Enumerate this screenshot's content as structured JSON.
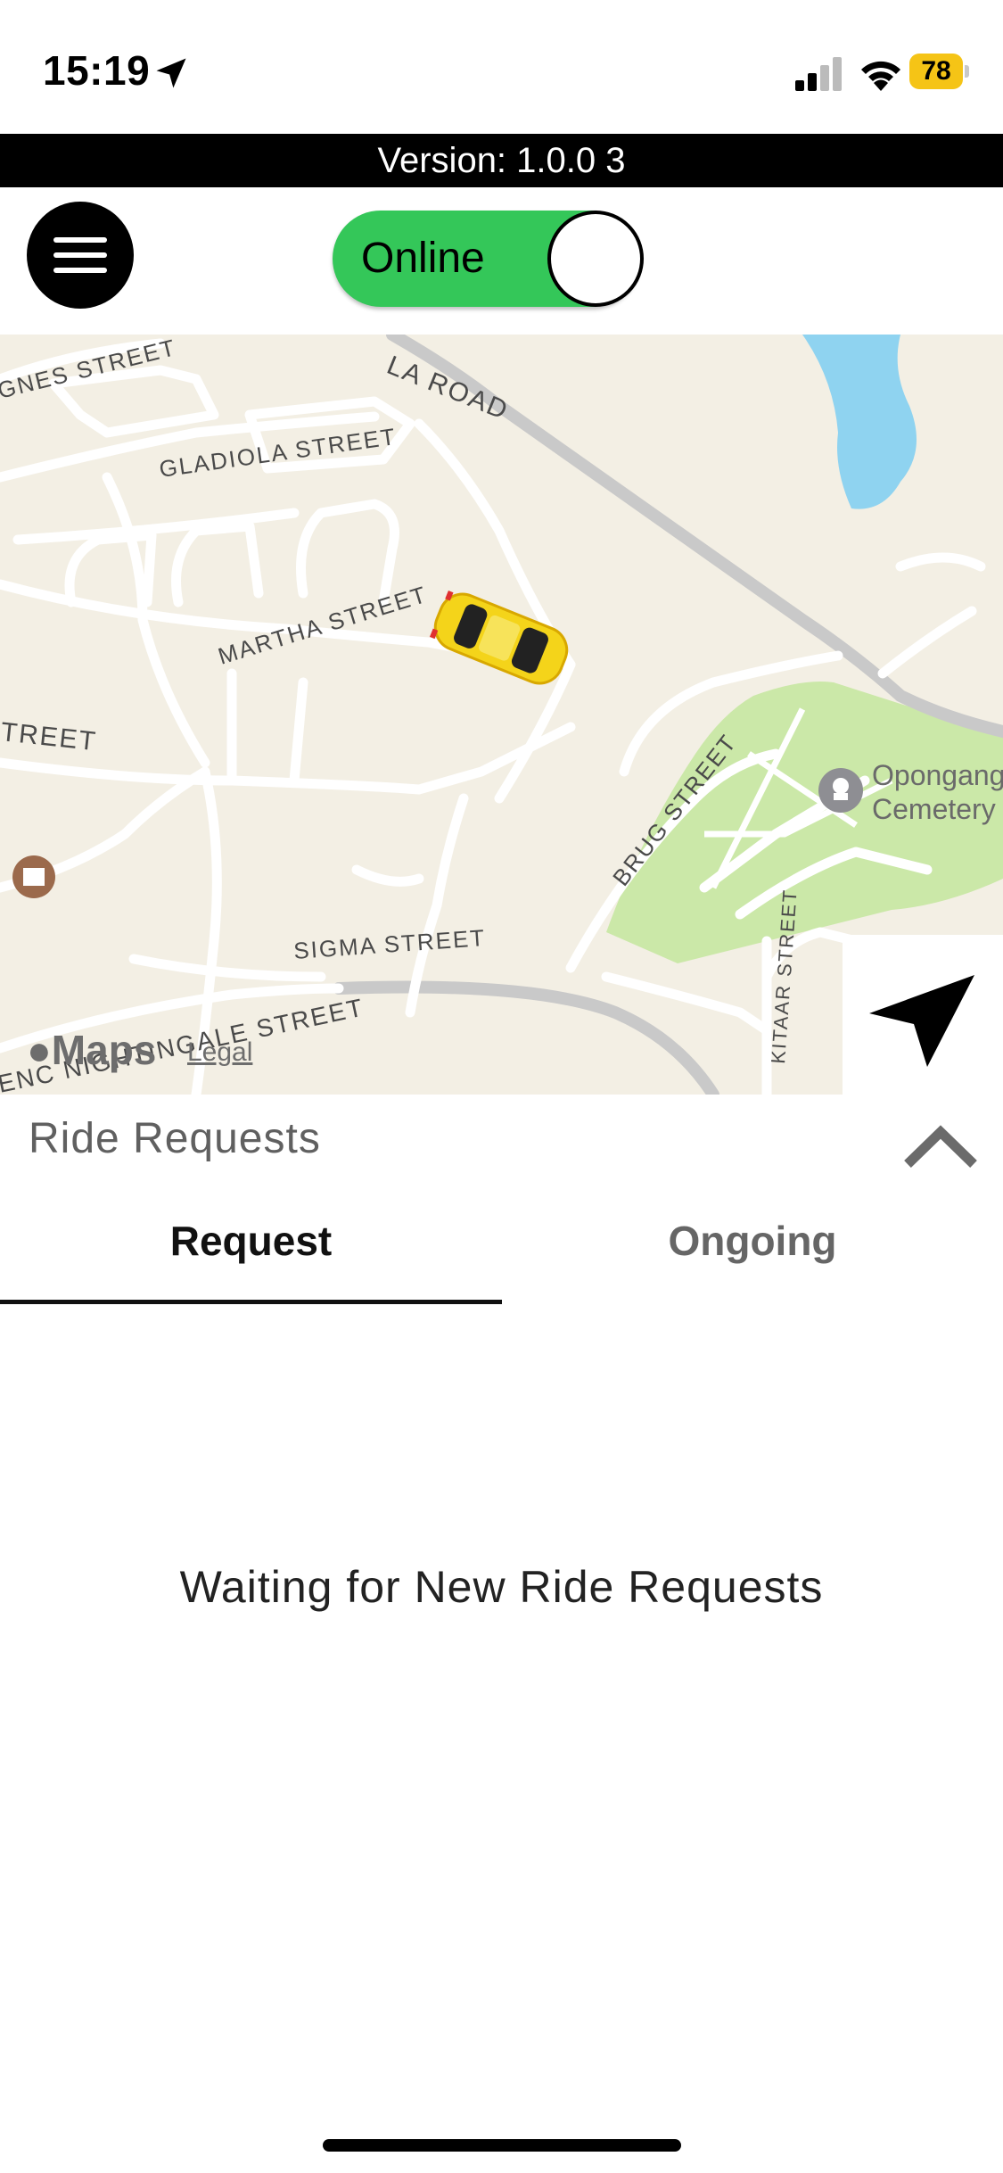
{
  "status_bar": {
    "time": "15:19",
    "battery": "78",
    "icons": [
      "location-arrow-icon",
      "signal-icon",
      "wifi-icon",
      "battery-icon"
    ]
  },
  "version_bar": {
    "text": "Version: 1.0.0 3"
  },
  "header": {
    "menu_icon": "hamburger-menu-icon",
    "toggle": {
      "label": "Online",
      "state": "on",
      "color": "#34c759"
    }
  },
  "map": {
    "street_labels": {
      "agnes": "GNES STREET",
      "road": "LA ROAD",
      "gladiola": "GLADIOLA STREET",
      "martha": "MARTHA STREET",
      "treet": "TREET",
      "brug": "BRUG STREET",
      "sigma": "SIGMA STREET",
      "kitaar": "KITAAR STREET",
      "nightingale": "ENC NIGHTINGALE STREET"
    },
    "poi": {
      "line1": "Opongang",
      "line2": "Cemetery"
    },
    "attribution": {
      "logo": "Maps",
      "legal": "Legal"
    },
    "locate_icon": "navigation-arrow-icon"
  },
  "ride_requests": {
    "title": "Ride Requests",
    "collapse_icon": "chevron-up-icon",
    "tabs": [
      {
        "label": "Request",
        "active": true
      },
      {
        "label": "Ongoing",
        "active": false
      }
    ],
    "empty_message": "Waiting for New Ride Requests"
  }
}
